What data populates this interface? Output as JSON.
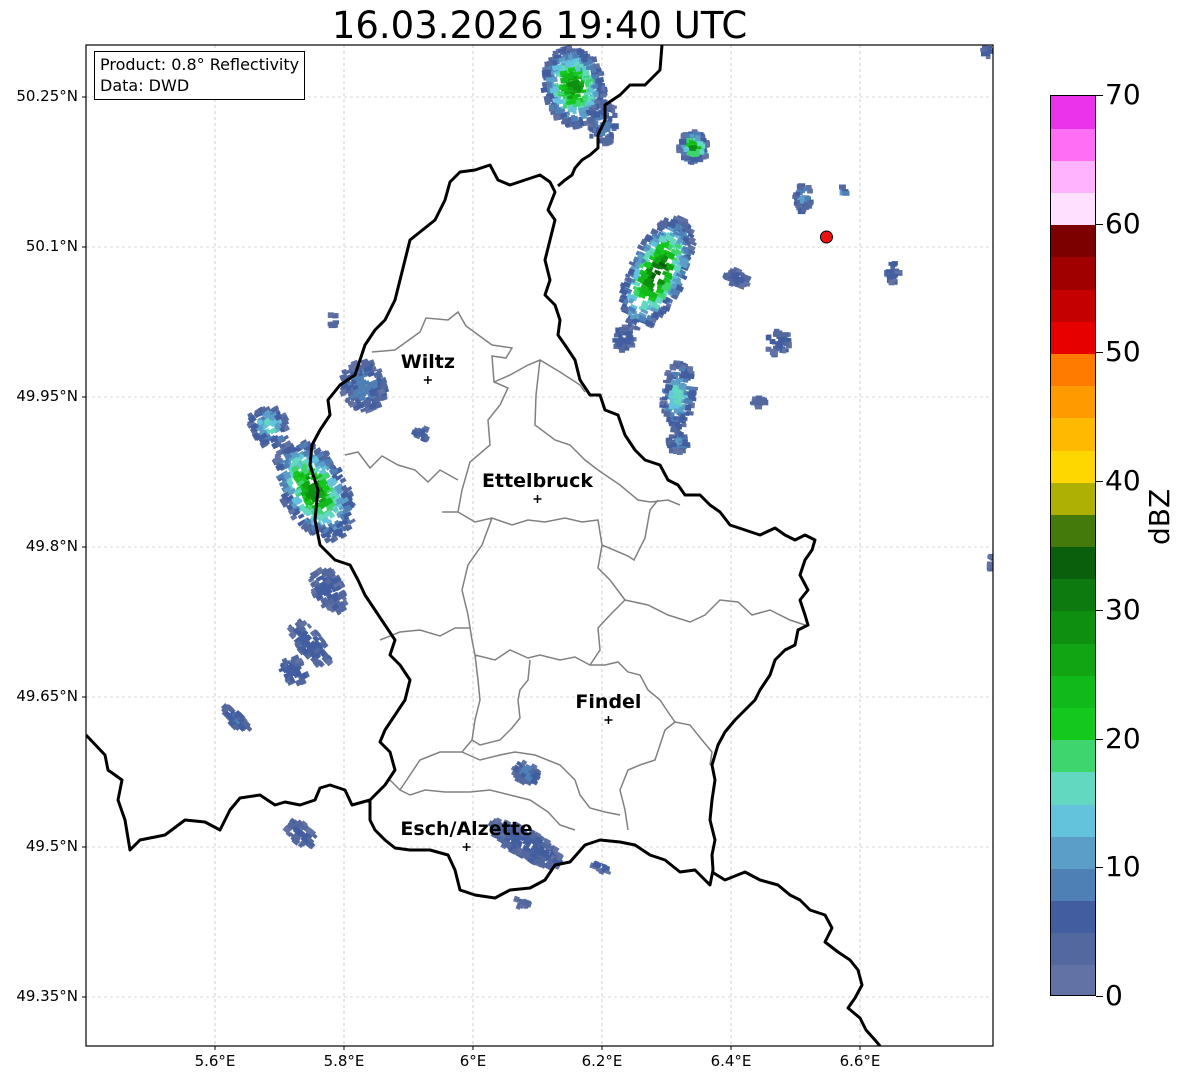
{
  "title": "16.03.2026 19:40 UTC",
  "info_box": {
    "product": "Product: 0.8° Reflectivity",
    "data": "Data: DWD"
  },
  "lat_labels": [
    "50.25°N",
    "50.1°N",
    "49.95°N",
    "49.8°N",
    "49.65°N",
    "49.5°N",
    "49.35°N"
  ],
  "lon_labels": [
    "5.6°E",
    "5.8°E",
    "6°E",
    "6.2°E",
    "6.4°E",
    "6.6°E"
  ],
  "cities": [
    {
      "name": "Wiltz",
      "lon": 5.93,
      "lat": 49.967
    },
    {
      "name": "Ettelbruck",
      "lon": 6.1,
      "lat": 49.848
    },
    {
      "name": "Findel",
      "lon": 6.21,
      "lat": 49.627
    },
    {
      "name": "Esch/Alzette",
      "lon": 5.99,
      "lat": 49.5
    }
  ],
  "radar_site": {
    "lon": 6.548,
    "lat": 50.11,
    "color": "#ee1111"
  },
  "colorbar": {
    "unit": "dBZ",
    "min": 0,
    "max": 70,
    "tick_labels": [
      "70",
      "60",
      "50",
      "40",
      "30",
      "20",
      "10",
      "0"
    ],
    "colors": [
      "#6272a4",
      "#52689e",
      "#425ea0",
      "#4e7fb5",
      "#5b9fc8",
      "#64c3dc",
      "#62d8c0",
      "#3ed46e",
      "#14c81e",
      "#12b91a",
      "#11a514",
      "#0f8f10",
      "#0c7a0e",
      "#095f0b",
      "#447a0c",
      "#aeb004",
      "#ffd700",
      "#ffb900",
      "#ff9a00",
      "#ff7b00",
      "#e60000",
      "#c40000",
      "#a10000",
      "#7d0000",
      "#ffe0ff",
      "#ffb3ff",
      "#ff6ef5",
      "#ea33ea"
    ]
  }
}
